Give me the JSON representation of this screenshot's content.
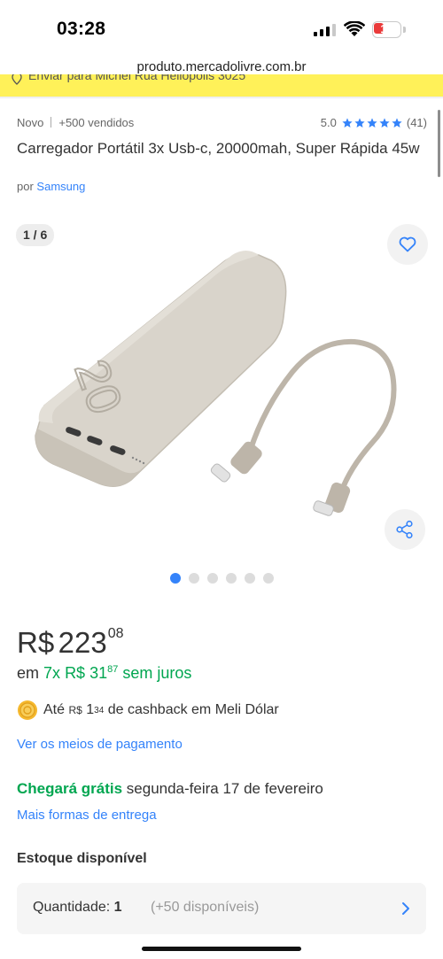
{
  "status_bar": {
    "time": "03:28",
    "battery_level": "15",
    "icons": [
      "signal-icon",
      "wifi-icon",
      "battery-icon"
    ]
  },
  "browser": {
    "url": "produto.mercadolivre.com.br"
  },
  "shipping_strip": {
    "text": "Enviar para Michel Rua Heliópolis 3025",
    "icon": "location-pin-icon"
  },
  "product": {
    "condition": "Novo",
    "sold": "+500 vendidos",
    "rating": "5.0",
    "stars": 5,
    "review_count": "(41)",
    "title": "Carregador Portátil 3x Usb-c, 20000mah, Super Rápida 45w",
    "seller_prefix": "por",
    "seller": "Samsung"
  },
  "gallery": {
    "counter": "1 / 6",
    "total_images": 6,
    "active_index": 0,
    "image_text": "20",
    "icons": [
      "heart-icon",
      "share-icon"
    ]
  },
  "price": {
    "currency": "R$",
    "main": "223",
    "cents": "08"
  },
  "installments": {
    "prefix": "em",
    "count": "7x",
    "currency": "R$",
    "value": "31",
    "cents": "87",
    "suffix": "sem juros"
  },
  "cashback": {
    "prefix": "Até",
    "currency": "R$",
    "value": "1",
    "cents": "34",
    "suffix": "de cashback em Meli Dólar"
  },
  "links": {
    "payment": "Ver os meios de pagamento",
    "delivery_options": "Mais formas de entrega"
  },
  "delivery": {
    "strong": "Chegará grátis",
    "date": "segunda-feira 17 de fevereiro"
  },
  "stock": {
    "title": "Estoque disponível",
    "quantity_label": "Quantidade:",
    "quantity_value": "1",
    "available": "(+50 disponíveis)"
  },
  "colors": {
    "accent_blue": "#3483fa",
    "green": "#00a650",
    "yellow": "#fff159"
  }
}
